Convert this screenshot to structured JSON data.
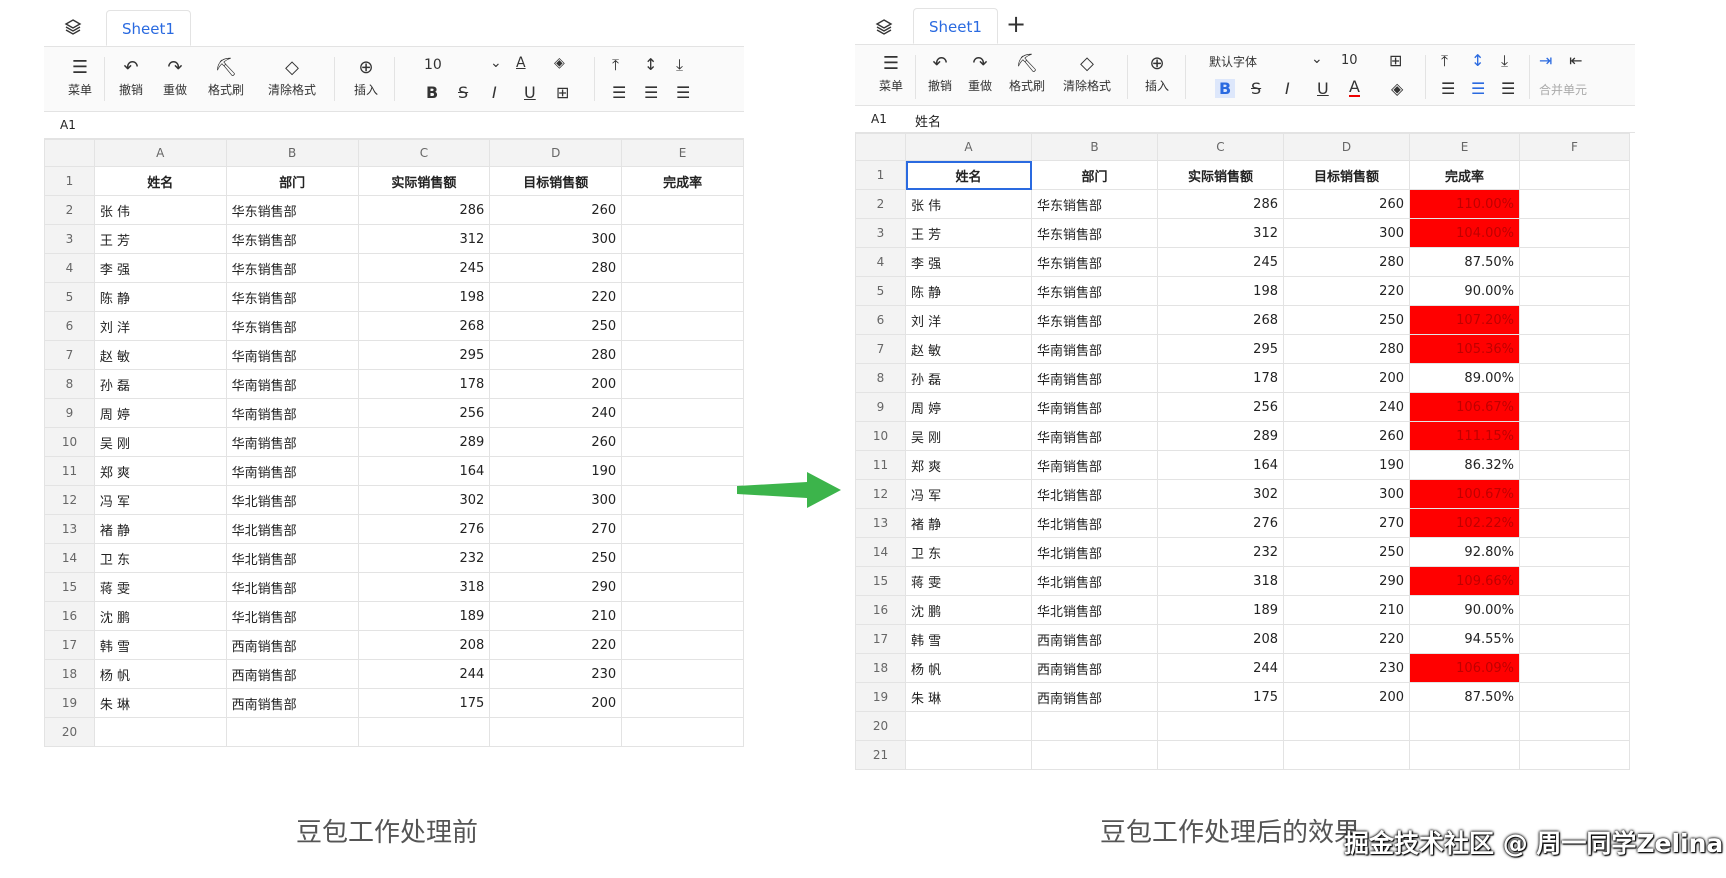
{
  "left": {
    "sheet_tab": "Sheet1",
    "toolbar": {
      "menu": "菜单",
      "undo": "撤销",
      "redo": "重做",
      "format_painter": "格式刷",
      "clear_format": "清除格式",
      "insert": "插入",
      "font_size": "10",
      "bold": "B",
      "strike": "S",
      "italic": "I",
      "underline": "U",
      "font_color": "A"
    },
    "cell_ref": "A1",
    "columns": [
      "A",
      "B",
      "C",
      "D",
      "E"
    ],
    "header": [
      "姓名",
      "部门",
      "实际销售额",
      "目标销售额",
      "完成率"
    ],
    "rows": [
      [
        "张 伟",
        "华东销售部",
        "286",
        "260",
        ""
      ],
      [
        "王 芳",
        "华东销售部",
        "312",
        "300",
        ""
      ],
      [
        "李 强",
        "华东销售部",
        "245",
        "280",
        ""
      ],
      [
        "陈 静",
        "华东销售部",
        "198",
        "220",
        ""
      ],
      [
        "刘 洋",
        "华东销售部",
        "268",
        "250",
        ""
      ],
      [
        "赵 敏",
        "华南销售部",
        "295",
        "280",
        ""
      ],
      [
        "孙 磊",
        "华南销售部",
        "178",
        "200",
        ""
      ],
      [
        "周 婷",
        "华南销售部",
        "256",
        "240",
        ""
      ],
      [
        "吴 刚",
        "华南销售部",
        "289",
        "260",
        ""
      ],
      [
        "郑 爽",
        "华南销售部",
        "164",
        "190",
        ""
      ],
      [
        "冯 军",
        "华北销售部",
        "302",
        "300",
        ""
      ],
      [
        "褚 静",
        "华北销售部",
        "276",
        "270",
        ""
      ],
      [
        "卫 东",
        "华北销售部",
        "232",
        "250",
        ""
      ],
      [
        "蒋 雯",
        "华北销售部",
        "318",
        "290",
        ""
      ],
      [
        "沈 鹏",
        "华北销售部",
        "189",
        "210",
        ""
      ],
      [
        "韩 雪",
        "西南销售部",
        "208",
        "220",
        ""
      ],
      [
        "杨 帆",
        "西南销售部",
        "244",
        "230",
        ""
      ],
      [
        "朱 琳",
        "西南销售部",
        "175",
        "200",
        ""
      ],
      [
        "",
        "",
        "",
        "",
        ""
      ]
    ],
    "caption": "豆包工作处理前"
  },
  "right": {
    "sheet_tab": "Sheet1",
    "add_sheet": "+",
    "toolbar": {
      "menu": "菜单",
      "undo": "撤销",
      "redo": "重做",
      "format_painter": "格式刷",
      "clear_format": "清除格式",
      "insert": "插入",
      "font_name": "默认字体",
      "font_size": "10",
      "bold": "B",
      "strike": "S",
      "italic": "I",
      "underline": "U",
      "font_color": "A",
      "merge": "合并单元"
    },
    "cell_ref": "A1",
    "formula": "姓名",
    "columns": [
      "A",
      "B",
      "C",
      "D",
      "E",
      "F"
    ],
    "header": [
      "姓名",
      "部门",
      "实际销售额",
      "目标销售额",
      "完成率",
      ""
    ],
    "rows": [
      [
        "张 伟",
        "华东销售部",
        "286",
        "260",
        "110.00%",
        ""
      ],
      [
        "王 芳",
        "华东销售部",
        "312",
        "300",
        "104.00%",
        ""
      ],
      [
        "李 强",
        "华东销售部",
        "245",
        "280",
        "87.50%",
        ""
      ],
      [
        "陈 静",
        "华东销售部",
        "198",
        "220",
        "90.00%",
        ""
      ],
      [
        "刘 洋",
        "华东销售部",
        "268",
        "250",
        "107.20%",
        ""
      ],
      [
        "赵 敏",
        "华南销售部",
        "295",
        "280",
        "105.36%",
        ""
      ],
      [
        "孙 磊",
        "华南销售部",
        "178",
        "200",
        "89.00%",
        ""
      ],
      [
        "周 婷",
        "华南销售部",
        "256",
        "240",
        "106.67%",
        ""
      ],
      [
        "吴 刚",
        "华南销售部",
        "289",
        "260",
        "111.15%",
        ""
      ],
      [
        "郑 爽",
        "华南销售部",
        "164",
        "190",
        "86.32%",
        ""
      ],
      [
        "冯 军",
        "华北销售部",
        "302",
        "300",
        "100.67%",
        ""
      ],
      [
        "褚 静",
        "华北销售部",
        "276",
        "270",
        "102.22%",
        ""
      ],
      [
        "卫 东",
        "华北销售部",
        "232",
        "250",
        "92.80%",
        ""
      ],
      [
        "蒋 雯",
        "华北销售部",
        "318",
        "290",
        "109.66%",
        ""
      ],
      [
        "沈 鹏",
        "华北销售部",
        "189",
        "210",
        "90.00%",
        ""
      ],
      [
        "韩 雪",
        "西南销售部",
        "208",
        "220",
        "94.55%",
        ""
      ],
      [
        "杨 帆",
        "西南销售部",
        "244",
        "230",
        "106.09%",
        ""
      ],
      [
        "朱 琳",
        "西南销售部",
        "175",
        "200",
        "87.50%",
        ""
      ],
      [
        "",
        "",
        "",
        "",
        "",
        ""
      ],
      [
        "",
        "",
        "",
        "",
        "",
        ""
      ]
    ],
    "caption": "豆包工作处理后的效果"
  },
  "watermark": "掘金技术社区 @ 周一同学Zelina",
  "colors": {
    "highlight": "#ff0000",
    "highlight_text": "#c00000",
    "accent": "#2a6ae0",
    "arrow": "#3cb44b"
  }
}
